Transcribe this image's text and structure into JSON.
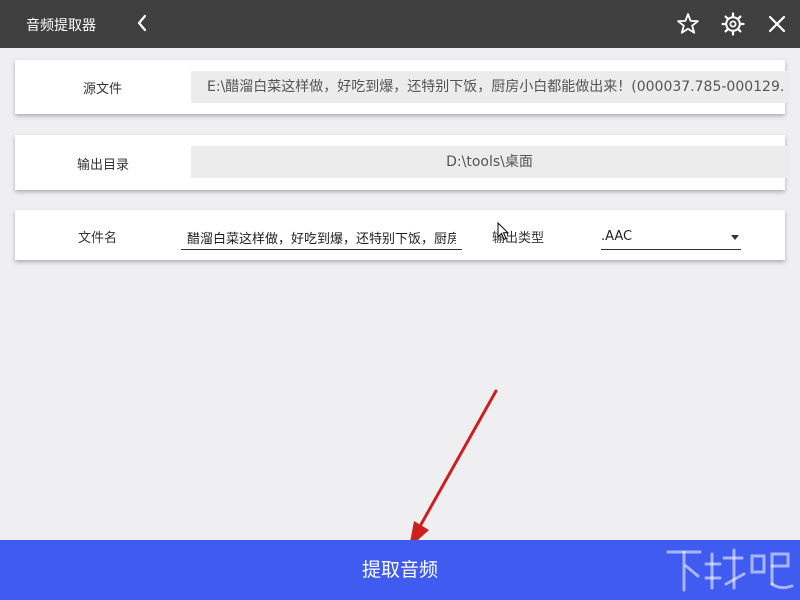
{
  "window": {
    "title": "音频提取器"
  },
  "fields": {
    "source": {
      "label": "源文件",
      "value": "E:\\醋溜白菜这样做，好吃到爆，还特别下饭，厨房小白都能做出来！(000037.785-000129."
    },
    "output_dir": {
      "label": "输出目录",
      "value": "D:\\tools\\桌面"
    },
    "filename": {
      "label": "文件名",
      "value": "醋溜白菜这样做，好吃到爆，还特别下饭，厨房小白都能做出来！"
    },
    "output_type": {
      "label": "输出类型",
      "selected": ".AAC"
    }
  },
  "actions": {
    "extract_label": "提取音频"
  },
  "icons": {
    "back": "chevron-left-icon",
    "favorite": "star-icon",
    "settings": "gear-icon",
    "close": "close-icon"
  },
  "watermark": {
    "text": "下载吧"
  },
  "colors": {
    "titlebar": "#3f3f3f",
    "primary": "#3f5bf0",
    "background": "#efeff1",
    "annotation": "#cc1f1f"
  }
}
